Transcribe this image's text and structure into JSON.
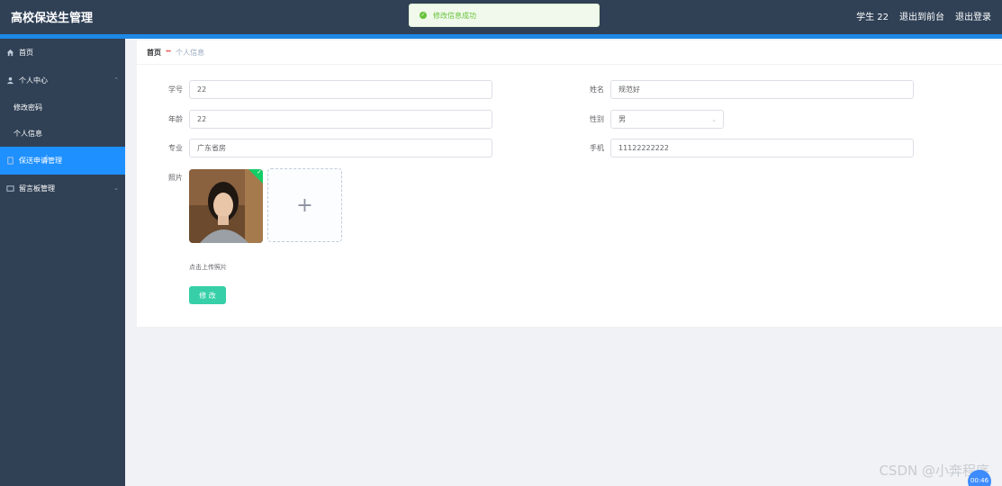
{
  "app": {
    "title": "高校保送生管理"
  },
  "header": {
    "user_label": "学生 22",
    "back_to_front_label": "退出到前台",
    "logout_label": "退出登录"
  },
  "toast": {
    "message": "修改信息成功"
  },
  "sidebar": {
    "items": [
      {
        "label": "首页"
      },
      {
        "label": "个人中心"
      },
      {
        "label": "修改密码"
      },
      {
        "label": "个人信息"
      },
      {
        "label": "保送申请管理"
      },
      {
        "label": "留言板管理"
      }
    ]
  },
  "breadcrumb": {
    "home": "首页",
    "separator": "ⵈ",
    "current": "个人信息"
  },
  "form": {
    "student_id_label": "学号",
    "student_id_value": "22",
    "name_label": "姓名",
    "name_value": "规范好",
    "age_label": "年龄",
    "age_value": "22",
    "gender_label": "性别",
    "gender_value": "男",
    "major_label": "专业",
    "major_value": "广东省房",
    "phone_label": "手机",
    "phone_value": "11122222222",
    "photo_label": "照片",
    "upload_hint": "点击上传照片",
    "submit_label": "修 改"
  },
  "watermark": "CSDN @小奔程序",
  "timer": "00:46",
  "colors": {
    "sidebar": "#304156",
    "accent": "#1e88e5",
    "active": "#1e90ff",
    "submit": "#36cfa8",
    "success": "#67c23a"
  }
}
